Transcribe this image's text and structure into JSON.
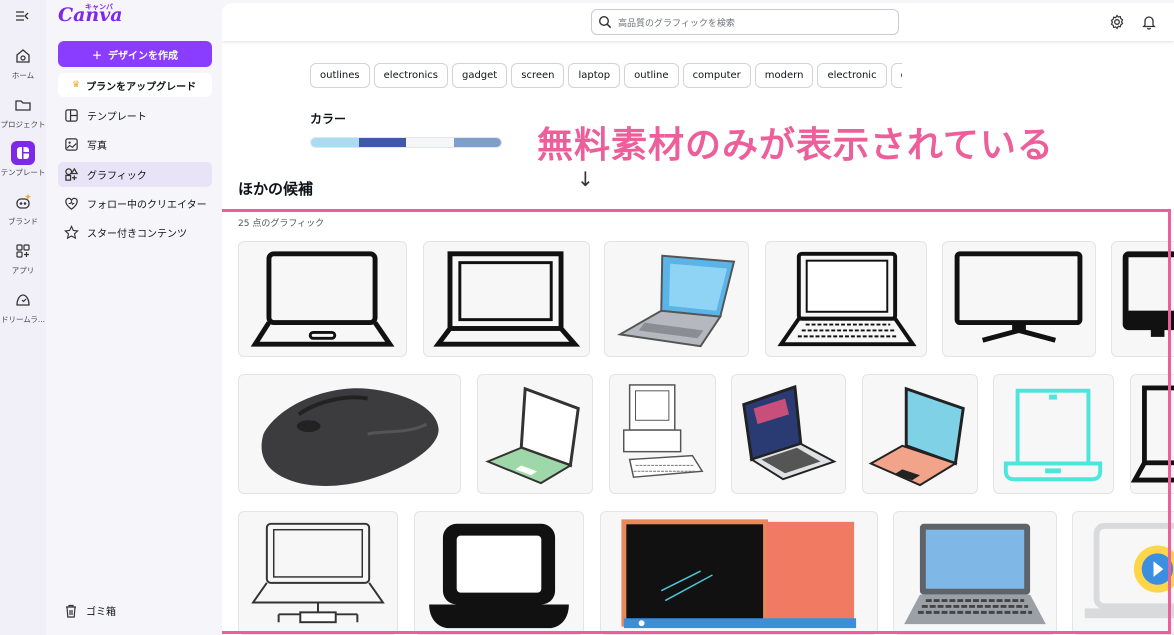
{
  "rail": {
    "items": [
      {
        "label": "ホーム",
        "icon": "home-icon"
      },
      {
        "label": "プロジェクト",
        "icon": "folder-icon"
      },
      {
        "label": "テンプレート",
        "icon": "template-icon"
      },
      {
        "label": "ブランド",
        "icon": "brand-icon"
      },
      {
        "label": "アプリ",
        "icon": "apps-icon"
      },
      {
        "label": "ドリームラ...",
        "icon": "dream-lab-icon"
      }
    ]
  },
  "panel": {
    "logo": "Canva",
    "logo_sub": "キャンバ",
    "create_label": "デザインを作成",
    "upgrade_label": "プランをアップグレード",
    "nav": [
      {
        "label": "テンプレート",
        "icon": "template-icon"
      },
      {
        "label": "写真",
        "icon": "photo-icon"
      },
      {
        "label": "グラフィック",
        "icon": "graphics-icon"
      },
      {
        "label": "フォロー中のクリエイター",
        "icon": "heart-icon"
      },
      {
        "label": "スター付きコンテンツ",
        "icon": "star-icon"
      }
    ],
    "trash_label": "ゴミ箱"
  },
  "search": {
    "placeholder": "高品質のグラフィックを検索"
  },
  "chips": [
    "outlines",
    "electronics",
    "gadget",
    "screen",
    "laptop",
    "outline",
    "computer",
    "modern",
    "electronic",
    "o"
  ],
  "color_section": {
    "title": "カラー",
    "swatches": [
      "#a7dcf3",
      "#3f59a8",
      "#f5f6f8",
      "#7e9fcc"
    ]
  },
  "annotation": "無料素材のみが表示されている",
  "arrow": "↓",
  "results": {
    "title": "ほかの候補",
    "count": "25 点のグラフィック"
  },
  "colors": {
    "accent": "#8b3dff",
    "highlight": "#ec5f9a"
  }
}
